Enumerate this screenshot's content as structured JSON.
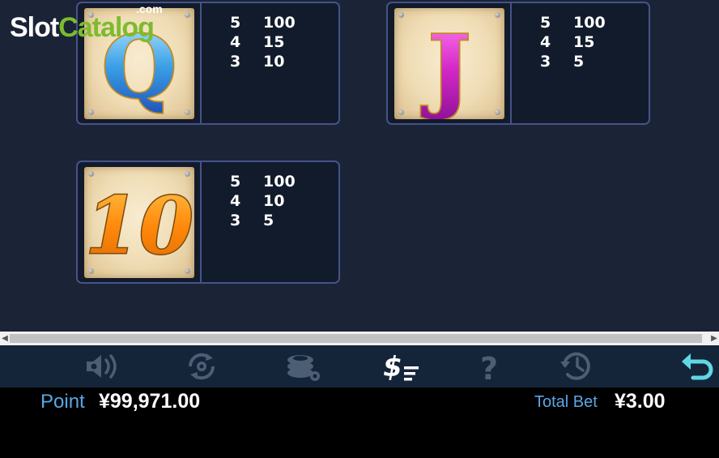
{
  "logo": {
    "slot": "Slot",
    "catalog": "Catalog",
    "com": ".com"
  },
  "paytable": [
    {
      "symbol": "Q",
      "pays": [
        {
          "count": "5",
          "value": "100"
        },
        {
          "count": "4",
          "value": "15"
        },
        {
          "count": "3",
          "value": "10"
        }
      ]
    },
    {
      "symbol": "J",
      "pays": [
        {
          "count": "5",
          "value": "100"
        },
        {
          "count": "4",
          "value": "15"
        },
        {
          "count": "3",
          "value": "5"
        }
      ]
    },
    {
      "symbol": "10",
      "pays": [
        {
          "count": "5",
          "value": "100"
        },
        {
          "count": "4",
          "value": "10"
        },
        {
          "count": "3",
          "value": "5"
        }
      ]
    }
  ],
  "toolbar": {
    "buttons": [
      "sound-icon",
      "autoplay-icon",
      "chips-settings-icon",
      "paytable-icon",
      "help-icon",
      "history-icon",
      "back-icon"
    ]
  },
  "status": {
    "point_label": "Point",
    "point_value": "¥99,971.00",
    "bet_label": "Total Bet",
    "bet_value": "¥3.00"
  },
  "colors": {
    "panel_bg": "#1a2436",
    "card_border": "#46528a",
    "toolbar_bg": "#14253a",
    "label_blue": "#5aa6e6",
    "active_icon": "#ffffff",
    "back_icon": "#5fd6e6",
    "inactive_icon": "#4c5e74"
  }
}
